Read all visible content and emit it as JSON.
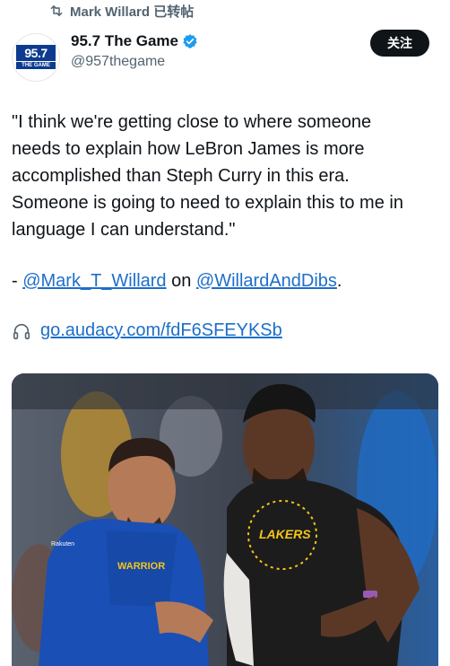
{
  "repost": {
    "text": "Mark Willard 已转帖"
  },
  "author": {
    "display_name": "95.7 The Game",
    "handle": "@957thegame",
    "logo_number": "95.7",
    "logo_sub": "THE GAME"
  },
  "follow_label": "关注",
  "tweet": {
    "quote_line1": "\"I think we're getting close to where someone",
    "quote_line2": "needs to explain how LeBron James is more",
    "quote_line3": "accomplished than Steph Curry in this era.",
    "quote_line4": "Someone is going to need to explain this to me in",
    "quote_line5": "language I can understand.\"",
    "credit_prefix": "- ",
    "mention1": "@Mark_T_Willard",
    "credit_middle": " on ",
    "mention2": "@WillardAndDibs",
    "credit_suffix": ".",
    "url": "go.audacy.com/fdF6SFEYKSb"
  },
  "photo": {
    "left_jersey": "WARRIOR",
    "left_patch": "Rakuten",
    "right_jersey": "LAKERS"
  },
  "colors": {
    "link": "#1d6fc8",
    "follow_bg": "#0f1419",
    "verified": "#1d9bf0"
  }
}
